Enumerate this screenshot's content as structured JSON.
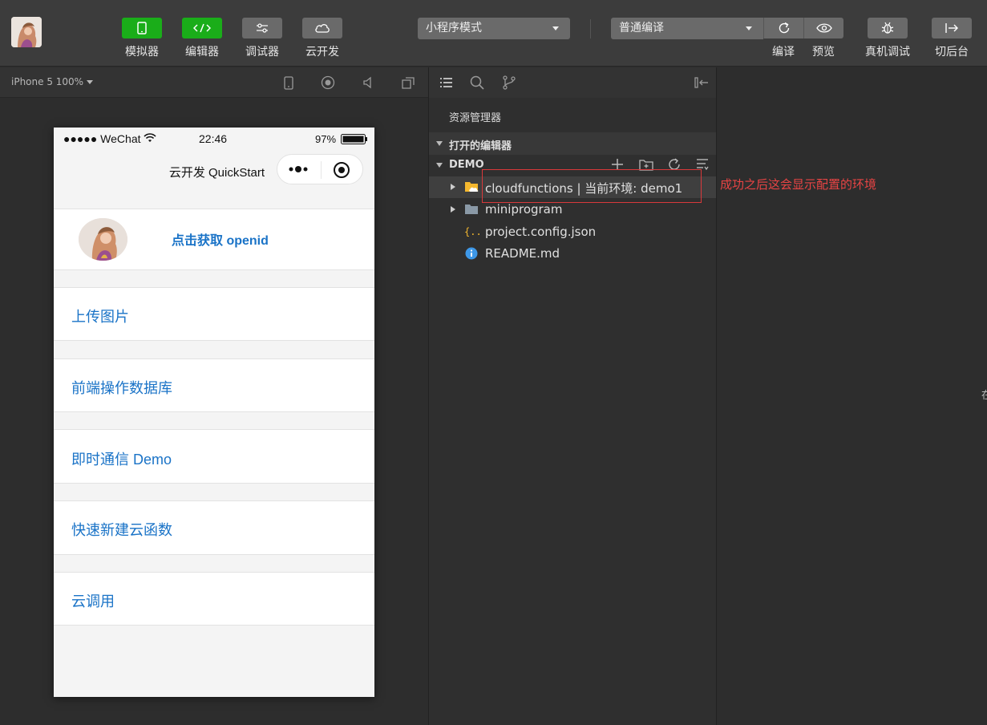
{
  "toolbar": {
    "mode_buttons": [
      {
        "label": "模拟器",
        "icon": "phone-icon"
      },
      {
        "label": "编辑器",
        "icon": "code-icon"
      },
      {
        "label": "调试器",
        "icon": "debug-toggle-icon"
      },
      {
        "label": "云开发",
        "icon": "cloud-icon"
      }
    ],
    "mode_select": "小程序模式",
    "compile_select": "普通编译",
    "actions": [
      {
        "label": "编译",
        "icon": "refresh-icon"
      },
      {
        "label": "预览",
        "icon": "eye-icon"
      },
      {
        "label": "真机调试",
        "icon": "bug-icon"
      },
      {
        "label": "切后台",
        "icon": "switch-background-icon"
      }
    ]
  },
  "simulator": {
    "device_label": "iPhone 5 100%",
    "status_bar": {
      "carrier": "●●●●● WeChat",
      "time": "22:46",
      "battery": "97%"
    },
    "nav_title": "云开发 QuickStart",
    "openid_button": "点击获取 openid",
    "menu_items": [
      "上传图片",
      "前端操作数据库",
      "即时通信 Demo",
      "快速新建云函数",
      "云调用"
    ]
  },
  "explorer": {
    "title": "资源管理器",
    "open_editors": "打开的编辑器",
    "project": "DEMO",
    "files": [
      {
        "name": "cloudfunctions | 当前环境: demo1",
        "type": "cloud-folder",
        "expandable": true,
        "selected": true
      },
      {
        "name": "miniprogram",
        "type": "folder",
        "expandable": true,
        "selected": false
      },
      {
        "name": "project.config.json",
        "type": "json",
        "expandable": false,
        "selected": false
      },
      {
        "name": "README.md",
        "type": "info",
        "expandable": false,
        "selected": false
      }
    ]
  },
  "annotation": {
    "text": "成功之后这会显示配置的环境",
    "color": "#e84444"
  },
  "right_edge_char": "在",
  "colors": {
    "accent_green": "#1aad19",
    "link_blue": "#1a73c7",
    "folder_yellow": "#f5b82e"
  }
}
